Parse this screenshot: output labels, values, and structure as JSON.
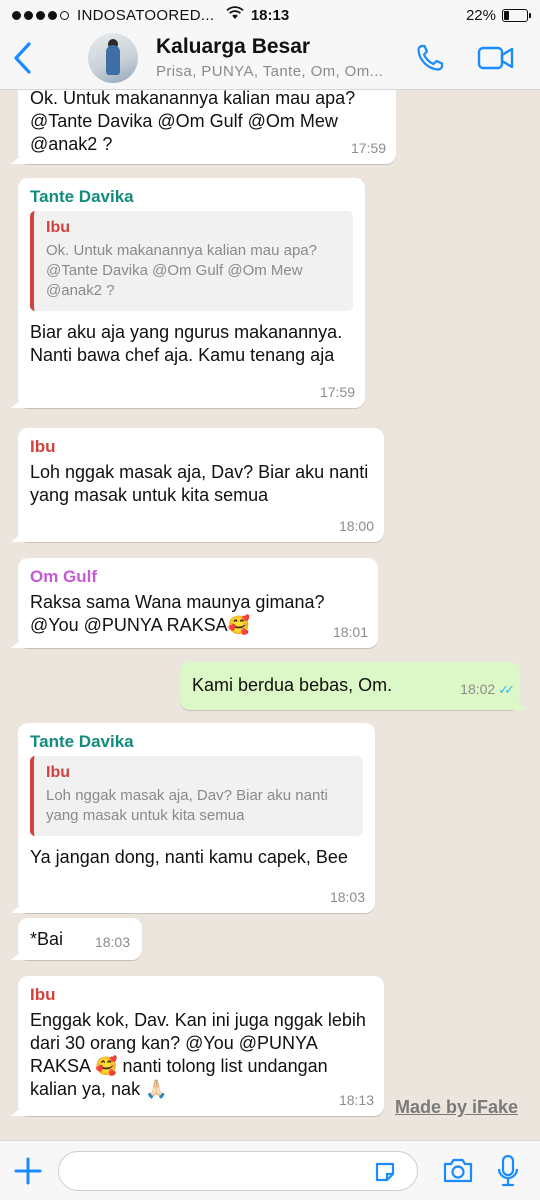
{
  "status_bar": {
    "carrier": "INDOSATOORED...",
    "time": "18:13",
    "battery_percent": "22%",
    "battery_level": 0.22
  },
  "header": {
    "back_icon": "chevron-left-icon",
    "title": "Kaluarga Besar",
    "subtitle": "Prisa, PUNYA, Tante, Om, Om...",
    "call_icon": "phone-icon",
    "video_icon": "video-camera-icon"
  },
  "colors": {
    "accent": "#1a8cff",
    "tante_davika": "#128c7e",
    "ibu": "#d3423e",
    "om_gulf": "#c55bd4",
    "outgoing_bubble": "#dcf8c6",
    "read_ticks": "#34b7f1",
    "chat_background": "#ece5dd"
  },
  "messages": [
    {
      "sender": "",
      "text": "Ok. Untuk makanannya kalian mau apa? @Tante Davika @Om Gulf @Om Mew @anak2 ?",
      "time": "17:59"
    },
    {
      "sender": "Tante Davika",
      "quote": {
        "author": "Ibu",
        "text": "Ok. Untuk makanannya kalian mau apa? @Tante Davika @Om Gulf @Om Mew @anak2 ?"
      },
      "text": "Biar aku aja yang ngurus makanannya. Nanti bawa chef aja. Kamu tenang aja",
      "time": "17:59"
    },
    {
      "sender": "Ibu",
      "text": "Loh nggak masak aja, Dav? Biar aku nanti yang masak untuk kita semua",
      "time": "18:00"
    },
    {
      "sender": "Om Gulf",
      "text": "Raksa sama Wana maunya gimana? @You @PUNYA RAKSA🥰",
      "time": "18:01"
    },
    {
      "sender": "",
      "outgoing": true,
      "text": "Kami berdua bebas, Om.",
      "time": "18:02",
      "ticks": "✓✓"
    },
    {
      "sender": "Tante Davika",
      "quote": {
        "author": "Ibu",
        "text": "Loh nggak masak aja, Dav? Biar aku nanti yang masak untuk kita semua"
      },
      "text": "Ya jangan dong, nanti kamu capek, Bee",
      "time": "18:03"
    },
    {
      "sender": "",
      "text": "*Bai",
      "time": "18:03"
    },
    {
      "sender": "Ibu",
      "text": "Enggak kok, Dav. Kan ini juga nggak lebih dari 30 orang kan? @You @PUNYA RAKSA 🥰 nanti tolong list undangan kalian ya, nak 🙏🏻",
      "time": "18:13"
    }
  ],
  "watermark": "Made by iFake",
  "input_bar": {
    "value": "",
    "plus_icon": "plus-icon",
    "sticker_icon": "sticker-icon",
    "camera_icon": "camera-icon",
    "mic_icon": "microphone-icon"
  }
}
